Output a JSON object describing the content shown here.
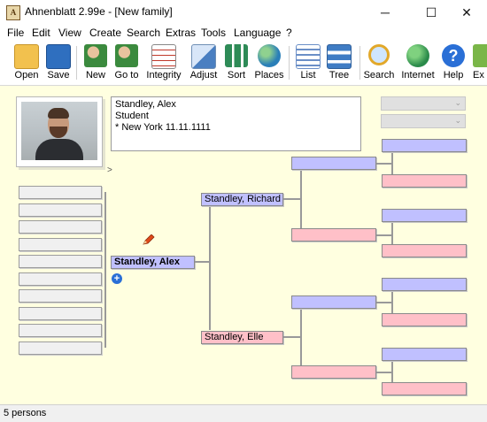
{
  "window": {
    "app_icon_letter": "A",
    "title": "Ahnenblatt 2.99e - [New family]",
    "controls": {
      "minimize": "─",
      "maximize": "☐",
      "close": "✕"
    }
  },
  "menu": [
    "File",
    "Edit",
    "View",
    "Create",
    "Search",
    "Extras",
    "Tools",
    "Language",
    "?"
  ],
  "toolbar": [
    {
      "label": "Open",
      "icon": "folder-open-icon",
      "color": "#f2c14e"
    },
    {
      "label": "Save",
      "icon": "floppy-disk-icon",
      "color": "#2f6fbf"
    },
    {
      "label": "New",
      "icon": "new-person-icon",
      "color": "#3b8a3e"
    },
    {
      "label": "Go to",
      "icon": "go-to-person-icon",
      "color": "#3b8a3e"
    },
    {
      "label": "Integrity",
      "icon": "checklist-icon",
      "color": "#c0392b"
    },
    {
      "label": "Adjust",
      "icon": "adjust-icon",
      "color": "#4a7fc1"
    },
    {
      "label": "Sort",
      "icon": "sort-icon",
      "color": "#2e8b57"
    },
    {
      "label": "Places",
      "icon": "globe-icon",
      "color": "#2a7fb8"
    },
    {
      "label": "List",
      "icon": "list-icon",
      "color": "#6b8fc7"
    },
    {
      "label": "Tree",
      "icon": "tree-icon",
      "color": "#3f7cc4"
    },
    {
      "label": "Search",
      "icon": "magnifier-icon",
      "color": "#e2a82a"
    },
    {
      "label": "Internet",
      "icon": "internet-globe-icon",
      "color": "#2a8a4a"
    },
    {
      "label": "Help",
      "icon": "help-icon",
      "color": "#2a6fd6"
    },
    {
      "label": "Ex",
      "icon": "exit-icon",
      "color": "#7ab648"
    }
  ],
  "person": {
    "name": "Standley, Alex",
    "occupation": "Student",
    "birth": "* New York 11.11.1111"
  },
  "tree": {
    "root": "Standley, Alex",
    "father": "Standley, Richard",
    "mother": "Standley, Elle"
  },
  "photo_nav": ">",
  "status": "5 persons",
  "colors": {
    "male": "#c0c0ff",
    "female": "#ffc0c8",
    "background": "#ffffe0",
    "sibling": "#f0f0f0"
  }
}
